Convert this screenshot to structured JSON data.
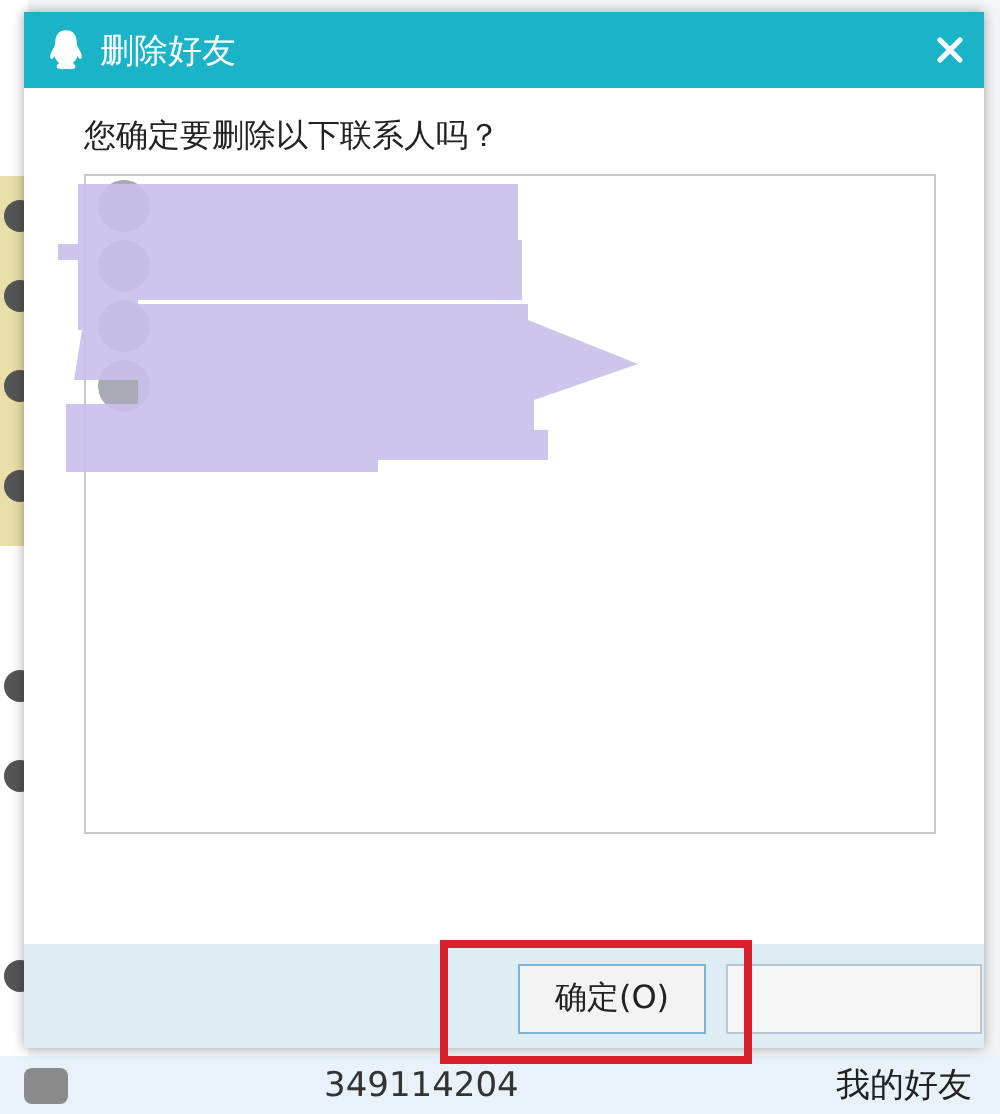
{
  "window": {
    "title": "删除好友"
  },
  "prompt": "您确定要删除以下联系人吗？",
  "contacts": [
    {
      "kind": "redacted"
    },
    {
      "kind": "redacted"
    },
    {
      "kind": "redacted"
    },
    {
      "kind": "redacted"
    }
  ],
  "buttons": [
    {
      "label": "确定(O)",
      "selected": true
    }
  ],
  "background_list": {
    "rows": [
      {
        "number": "349114204",
        "group": "我的好友"
      }
    ]
  }
}
